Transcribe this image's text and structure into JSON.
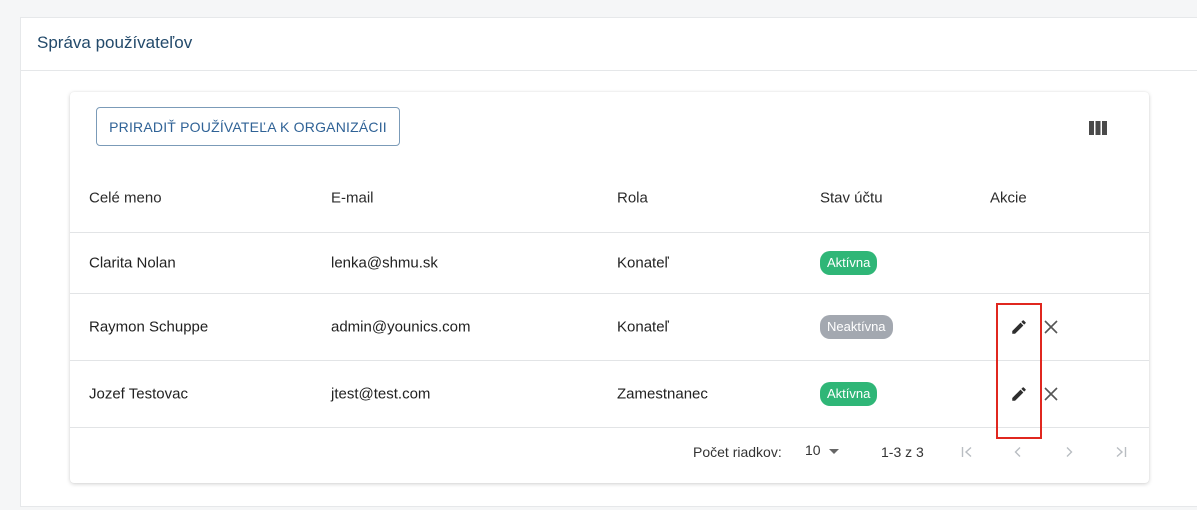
{
  "panel": {
    "title": "Správa používateľov"
  },
  "toolbar": {
    "assign_label": "PRIRADIŤ POUŽÍVATEĽA K ORGANIZÁCII",
    "columns_icon": "view-column-icon"
  },
  "table": {
    "headers": {
      "name": "Celé meno",
      "email": "E-mail",
      "role": "Rola",
      "status": "Stav účtu",
      "actions": "Akcie"
    },
    "rows": [
      {
        "name": "Clarita Nolan",
        "email": "lenka@shmu.sk",
        "role": "Konateľ",
        "status": "Aktívna",
        "status_type": "active",
        "actions": false
      },
      {
        "name": "Raymon Schuppe",
        "email": "admin@younics.com",
        "role": "Konateľ",
        "status": "Neaktívna",
        "status_type": "inactive",
        "actions": true
      },
      {
        "name": "Jozef Testovac",
        "email": "jtest@test.com",
        "role": "Zamestnanec",
        "status": "Aktívna",
        "status_type": "active",
        "actions": true
      }
    ]
  },
  "footer": {
    "rows_per_page_label": "Počet riadkov:",
    "rows_per_page_value": "10",
    "range_text": "1-3 z 3"
  },
  "colors": {
    "accent": "#2f6296",
    "active": "#2fb677",
    "inactive": "#a3a8b0",
    "highlight": "#e0271f"
  }
}
